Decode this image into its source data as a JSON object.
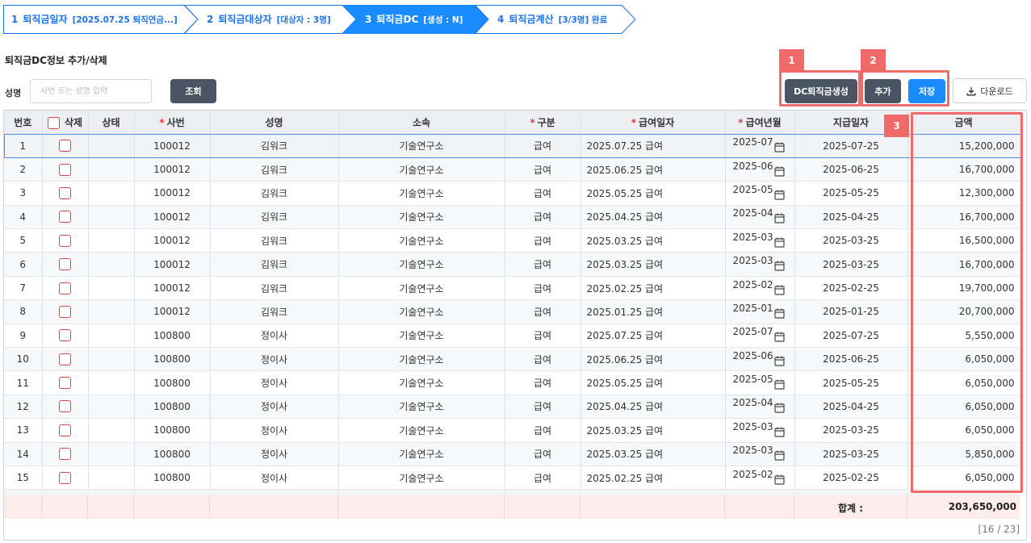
{
  "stepper": [
    {
      "num": "1",
      "label": "퇴직금일자",
      "sub": "[2025.07.25 퇴직연금...]",
      "active": false
    },
    {
      "num": "2",
      "label": "퇴직금대상자",
      "sub": "[대상자 : 3명]",
      "active": false
    },
    {
      "num": "3",
      "label": "퇴직금DC",
      "sub": "[생성 : N]",
      "active": true
    },
    {
      "num": "4",
      "label": "퇴직금계산",
      "sub": "[3/3명] 완료",
      "active": false
    }
  ],
  "section_title": "퇴직금DC정보 추가/삭제",
  "search": {
    "label": "성명",
    "placeholder": "사번 또는 성명 입력",
    "value": "",
    "button": "조회"
  },
  "toolbar": {
    "dc_button": "DC퇴직금생성",
    "add_button": "추가",
    "save_button": "저장",
    "download_button": "다운로드"
  },
  "markers": [
    "1",
    "2",
    "3"
  ],
  "colors": {
    "primary": "#1a8cff",
    "dark_button": "#4a5462",
    "marker": "#f06a6a",
    "required": "#e53935"
  },
  "columns": [
    {
      "label": "번호",
      "required": false
    },
    {
      "label": "삭제",
      "required": false
    },
    {
      "label": "상태",
      "required": false
    },
    {
      "label": "사번",
      "required": true
    },
    {
      "label": "성명",
      "required": false
    },
    {
      "label": "소속",
      "required": false
    },
    {
      "label": "구분",
      "required": true
    },
    {
      "label": "급여일자",
      "required": true
    },
    {
      "label": "급여년월",
      "required": true
    },
    {
      "label": "지급일자",
      "required": false
    },
    {
      "label": "금액",
      "required": false
    }
  ],
  "rows": [
    {
      "no": "1",
      "status": "",
      "emp_no": "100012",
      "name": "김워크",
      "dept": "기술연구소",
      "type": "급여",
      "pay_date": "2025.07.25 급여",
      "pay_month": "2025-07",
      "pay_day": "2025-07-25",
      "amount": "15,200,000"
    },
    {
      "no": "2",
      "status": "",
      "emp_no": "100012",
      "name": "김워크",
      "dept": "기술연구소",
      "type": "급여",
      "pay_date": "2025.06.25 급여",
      "pay_month": "2025-06",
      "pay_day": "2025-06-25",
      "amount": "16,700,000"
    },
    {
      "no": "3",
      "status": "",
      "emp_no": "100012",
      "name": "김워크",
      "dept": "기술연구소",
      "type": "급여",
      "pay_date": "2025.05.25 급여",
      "pay_month": "2025-05",
      "pay_day": "2025-05-25",
      "amount": "12,300,000"
    },
    {
      "no": "4",
      "status": "",
      "emp_no": "100012",
      "name": "김워크",
      "dept": "기술연구소",
      "type": "급여",
      "pay_date": "2025.04.25 급여",
      "pay_month": "2025-04",
      "pay_day": "2025-04-25",
      "amount": "16,700,000"
    },
    {
      "no": "5",
      "status": "",
      "emp_no": "100012",
      "name": "김워크",
      "dept": "기술연구소",
      "type": "급여",
      "pay_date": "2025.03.25 급여",
      "pay_month": "2025-03",
      "pay_day": "2025-03-25",
      "amount": "16,500,000"
    },
    {
      "no": "6",
      "status": "",
      "emp_no": "100012",
      "name": "김워크",
      "dept": "기술연구소",
      "type": "급여",
      "pay_date": "2025.03.25 급여",
      "pay_month": "2025-03",
      "pay_day": "2025-03-25",
      "amount": "16,700,000"
    },
    {
      "no": "7",
      "status": "",
      "emp_no": "100012",
      "name": "김워크",
      "dept": "기술연구소",
      "type": "급여",
      "pay_date": "2025.02.25 급여",
      "pay_month": "2025-02",
      "pay_day": "2025-02-25",
      "amount": "19,700,000"
    },
    {
      "no": "8",
      "status": "",
      "emp_no": "100012",
      "name": "김워크",
      "dept": "기술연구소",
      "type": "급여",
      "pay_date": "2025.01.25 급여",
      "pay_month": "2025-01",
      "pay_day": "2025-01-25",
      "amount": "20,700,000"
    },
    {
      "no": "9",
      "status": "",
      "emp_no": "100800",
      "name": "정이사",
      "dept": "기술연구소",
      "type": "급여",
      "pay_date": "2025.07.25 급여",
      "pay_month": "2025-07",
      "pay_day": "2025-07-25",
      "amount": "5,550,000"
    },
    {
      "no": "10",
      "status": "",
      "emp_no": "100800",
      "name": "정이사",
      "dept": "기술연구소",
      "type": "급여",
      "pay_date": "2025.06.25 급여",
      "pay_month": "2025-06",
      "pay_day": "2025-06-25",
      "amount": "6,050,000"
    },
    {
      "no": "11",
      "status": "",
      "emp_no": "100800",
      "name": "정이사",
      "dept": "기술연구소",
      "type": "급여",
      "pay_date": "2025.05.25 급여",
      "pay_month": "2025-05",
      "pay_day": "2025-05-25",
      "amount": "6,050,000"
    },
    {
      "no": "12",
      "status": "",
      "emp_no": "100800",
      "name": "정이사",
      "dept": "기술연구소",
      "type": "급여",
      "pay_date": "2025.04.25 급여",
      "pay_month": "2025-04",
      "pay_day": "2025-04-25",
      "amount": "6,050,000"
    },
    {
      "no": "13",
      "status": "",
      "emp_no": "100800",
      "name": "정이사",
      "dept": "기술연구소",
      "type": "급여",
      "pay_date": "2025.03.25 급여",
      "pay_month": "2025-03",
      "pay_day": "2025-03-25",
      "amount": "6,050,000"
    },
    {
      "no": "14",
      "status": "",
      "emp_no": "100800",
      "name": "정이사",
      "dept": "기술연구소",
      "type": "급여",
      "pay_date": "2025.03.25 급여",
      "pay_month": "2025-03",
      "pay_day": "2025-03-25",
      "amount": "5,850,000"
    },
    {
      "no": "15",
      "status": "",
      "emp_no": "100800",
      "name": "정이사",
      "dept": "기술연구소",
      "type": "급여",
      "pay_date": "2025.02.25 급여",
      "pay_month": "2025-02",
      "pay_day": "2025-02-25",
      "amount": "6,050,000"
    }
  ],
  "summary": {
    "label": "합계 :",
    "total": "203,650,000"
  },
  "pager": "[16 / 23]"
}
